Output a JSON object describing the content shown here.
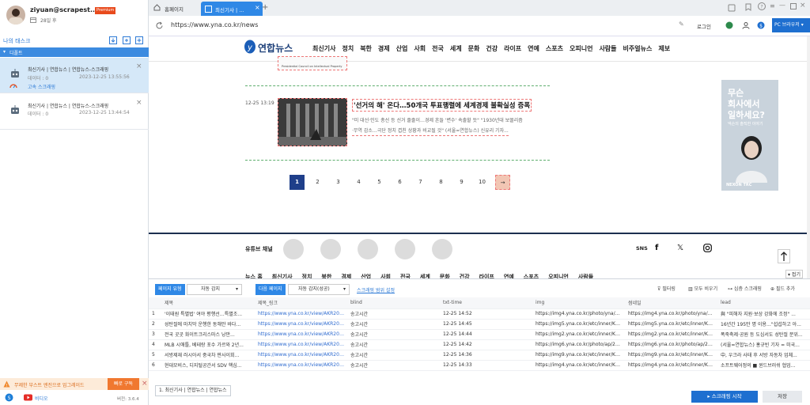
{
  "sidebar": {
    "username": "ziyuan@scrapest...",
    "premium": "Premium",
    "days": "28일 후",
    "my_tasks": "나의 태스크",
    "group": "디폴트",
    "tasks": [
      {
        "title": "최신기사 | 연합뉴스 | 연합뉴스-스크래핑",
        "data_label": "데이터 : 0",
        "date": "2023-12-25 13:55:56",
        "mode": "고속 스크래핑"
      },
      {
        "title": "최신기사 | 연합뉴스 | 연합뉴스-스크래핑",
        "data_label": "데이터 : 0",
        "date": "2023-12-25 13:44:54",
        "mode": ""
      }
    ],
    "upgrade_text": "무제한 부스트 엔진으로 업그레이드",
    "subscribe": "빠로 구독",
    "video": "비디오",
    "version": "버전: 3.6.4"
  },
  "browser": {
    "tabs": [
      "홈페이지",
      "최신기사 | ..."
    ],
    "url": "https://www.yna.co.kr/news",
    "login": "로그인",
    "pc_browser": "PC 브라우저"
  },
  "site": {
    "logo": "연합뉴스",
    "nav": [
      "최신기사",
      "정치",
      "북한",
      "경제",
      "산업",
      "사회",
      "전국",
      "세계",
      "문화",
      "건강",
      "라이프",
      "연예",
      "스포츠",
      "오피니언",
      "사람들",
      "비주얼뉴스",
      "제보"
    ],
    "article_time": "12-25 13:19",
    "article_title": "'선거의 해' 온다…50개국 투표행렬에 세계경제 불확실성 증폭",
    "article_summary_1": "\"미 대선·인도 총선 등 선거 줄줄이…경제 흔들 '변수' 속출할 듯\" \"1930년대 보몰리즘",
    "article_summary_2": "·무역 감소…극단 정치 겹친 상황과 비교될 것\" (서울=연합뉴스) 신유리 기자...",
    "prev_caption": "Presidential Council on Intellectual Property",
    "pages": [
      "1",
      "2",
      "3",
      "4",
      "5",
      "6",
      "7",
      "8",
      "9",
      "10",
      "→"
    ],
    "youtube_label": "유튜브 채널",
    "sns_label": "SNS",
    "ad_line1": "무슨",
    "ad_line2": "회사에서",
    "ad_line3": "일하세요?",
    "ad_sub": "넥슨의 솔직한 이야기",
    "ad_brand": "NEXON TRC",
    "footer_nav": [
      "뉴스 홈",
      "최신기사",
      "정치",
      "북한",
      "경제",
      "산업",
      "사회",
      "전국",
      "세계",
      "문화",
      "건강",
      "라이프",
      "연예",
      "스포츠",
      "오피니언",
      "사람들"
    ],
    "collapse": "접기"
  },
  "panel": {
    "page_type_label": "페이지 유형",
    "page_type_value": "자동 감지",
    "next_page_label": "다음 페이지",
    "next_page_value": "자동 감지(성공)",
    "scrape_range": "스크래핑 범위 설정",
    "filter": "필터링",
    "clear_all": "모두 비우기",
    "deep_scrape": "심층 스크래핑",
    "add_field": "필드 추가",
    "columns": [
      "제목",
      "제목_링크",
      "blind",
      "txt-time",
      "img",
      "썸네일",
      "lead"
    ],
    "rows": [
      [
        "1",
        "'이태원 특별법' 여야 평행선…특별조...",
        "https://www.yna.co.kr/view/AKR2023...",
        "송고시간",
        "12-25 14:52",
        "https://img4.yna.co.kr/photo/yna/YH/...",
        "https://img4.yna.co.kr/photo/yna/YH/...",
        "與 \"피해자 지원·보상 강화에 조정\" ..."
      ],
      [
        "2",
        "성탄절에 마치막 운행한 동해안 바다...",
        "https://www.yna.co.kr/view/AKR2023...",
        "송고시간",
        "12-25 14:45",
        "https://img5.yna.co.kr/etc/inner/KR/2...",
        "https://img5.yna.co.kr/etc/inner/KR/2...",
        "16년간 195만 명 이용…\"섭섭하고 아..."
      ],
      [
        "3",
        "전국 곳곳 화이트크리스마스 낭만...",
        "https://www.yna.co.kr/view/AKR2023...",
        "송고시간",
        "12-25 14:44",
        "https://img2.yna.co.kr/etc/inner/KR/2...",
        "https://img2.yna.co.kr/etc/inner/KR/2...",
        "폭죽축제·공원 등 도심서도 성탄절 분위..."
      ],
      [
        "4",
        "MLB 시애틀, 베테랑 포수 가르와 2년...",
        "https://www.yna.co.kr/view/AKR2023...",
        "송고시간",
        "12-25 14:42",
        "https://img6.yna.co.kr/photo/ap/2023...",
        "https://img6.yna.co.kr/photo/ap/2023...",
        "(서울=연합뉴스) 홍규빈 기자 = 미국..."
      ],
      [
        "5",
        "서방제재 러시아서 중국차 판사이회...",
        "https://www.yna.co.kr/view/AKR2023...",
        "송고시간",
        "12-25 14:36",
        "https://img9.yna.co.kr/etc/inner/KR/2...",
        "https://img9.yna.co.kr/etc/inner/KR/2...",
        "中, 우크라 사태 후 서방 자동차 업체..."
      ],
      [
        "6",
        "현대모비스, 디지털공간서 SDV 핵심...",
        "https://www.yna.co.kr/view/AKR2023...",
        "송고시간",
        "12-25 14:33",
        "https://img4.yna.co.kr/etc/inner/KR/2...",
        "https://img4.yna.co.kr/etc/inner/KR/2...",
        "소프트웨어정의 ■ 윈드브러쉬 협업..."
      ]
    ],
    "bottom_tab": "1. 최신기사 | 연합뉴스 | 연합뉴스",
    "start_button": "스크래핑 시작",
    "save_button": "저장"
  },
  "colors": {
    "accent": "#1677d2",
    "sidebar_select": "#d5e8f8",
    "orange": "#f08a30"
  }
}
